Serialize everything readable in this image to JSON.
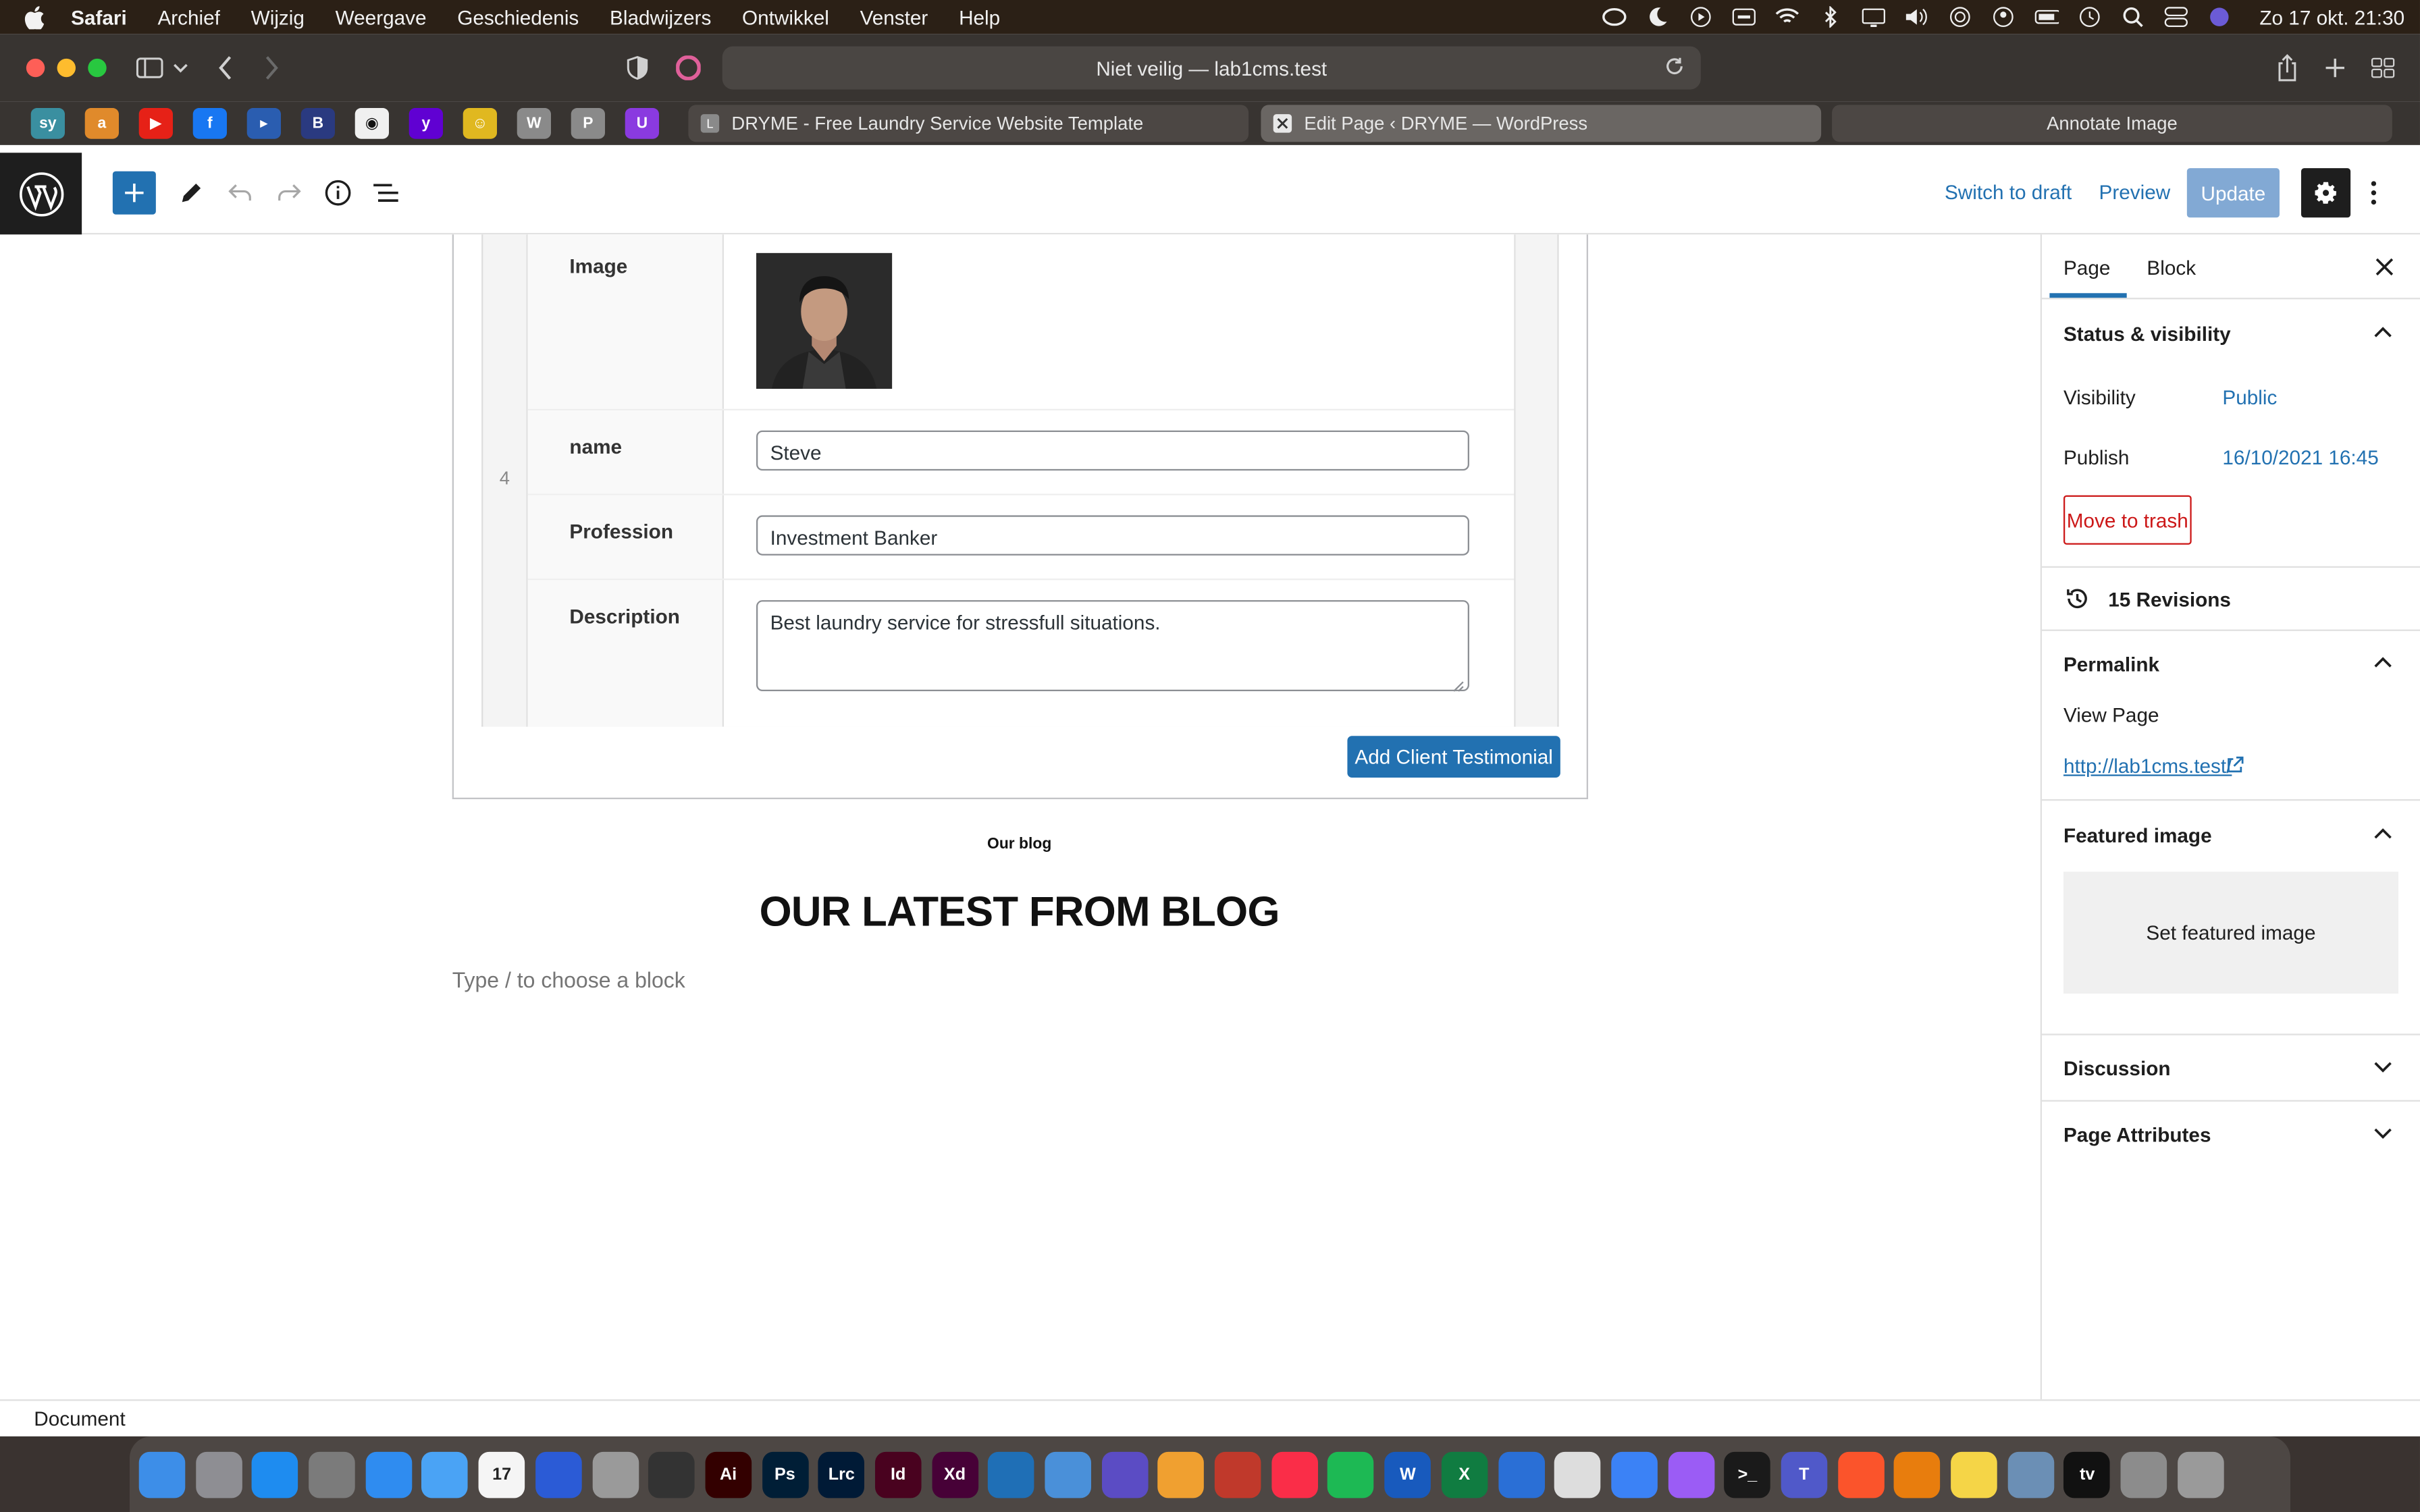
{
  "menubar": {
    "items": [
      "Safari",
      "Archief",
      "Wijzig",
      "Weergave",
      "Geschiedenis",
      "Bladwijzers",
      "Ontwikkel",
      "Venster",
      "Help"
    ],
    "clock": "Zo 17 okt.  21:30"
  },
  "browser": {
    "address": "Niet veilig — lab1cms.test",
    "tabs": [
      {
        "label": "DRYME - Free Laundry Service Website Template",
        "favicon": "L"
      },
      {
        "label": "Edit Page ‹ DRYME — WordPress",
        "favicon": "wp"
      },
      {
        "label": "Annotate Image",
        "favicon": ""
      }
    ],
    "favorites": [
      "sy",
      "a",
      "youtube",
      "facebook",
      "play",
      "B",
      "github",
      "y",
      "slack",
      "W",
      "P",
      "U"
    ]
  },
  "wp_header": {
    "switch_to_draft": "Switch to draft",
    "preview": "Preview",
    "update": "Update"
  },
  "testimonial": {
    "row_number": "4",
    "image_label": "Image",
    "name_label": "name",
    "name_value": "Steve",
    "profession_label": "Profession",
    "profession_value": "Investment Banker",
    "description_label": "Description",
    "description_value": "Best laundry service for stressfull situations.",
    "add_button": "Add Client Testimonial"
  },
  "blog": {
    "subtitle": "Our blog",
    "title": "OUR LATEST FROM BLOG",
    "placeholder": "Type / to choose a block"
  },
  "sidebar": {
    "tabs": [
      "Page",
      "Block"
    ],
    "status_visibility": "Status & visibility",
    "visibility_label": "Visibility",
    "visibility_value": "Public",
    "publish_label": "Publish",
    "publish_value": "16/10/2021 16:45",
    "move_to_trash": "Move to trash",
    "revisions": "15 Revisions",
    "permalink": "Permalink",
    "view_page": "View Page",
    "permalink_url": "http://lab1cms.test/",
    "featured_image": "Featured image",
    "set_featured_image": "Set featured image",
    "discussion": "Discussion",
    "page_attributes": "Page Attributes"
  },
  "footer": {
    "breadcrumb": "Document"
  },
  "dock": {
    "apps": [
      {
        "name": "finder",
        "color": "#3d8ee8",
        "label": ""
      },
      {
        "name": "launchpad",
        "color": "#8e8e93",
        "label": ""
      },
      {
        "name": "app-store",
        "color": "#1e8cf0",
        "label": ""
      },
      {
        "name": "system-preferences",
        "color": "#7b7b7b",
        "label": ""
      },
      {
        "name": "safari",
        "color": "#2f8cf0",
        "label": ""
      },
      {
        "name": "mail",
        "color": "#4aa3f5",
        "label": ""
      },
      {
        "name": "calendar",
        "color": "#f5f5f5",
        "label": "17"
      },
      {
        "name": "siri",
        "color": "#2b5bd6",
        "label": ""
      },
      {
        "name": "compressor",
        "color": "#9a9a9a",
        "label": ""
      },
      {
        "name": "final-cut",
        "color": "#333333",
        "label": ""
      },
      {
        "name": "illustrator",
        "color": "#330000",
        "label": "Ai"
      },
      {
        "name": "photoshop",
        "color": "#001e36",
        "label": "Ps"
      },
      {
        "name": "lightroom-classic",
        "color": "#001a36",
        "label": "Lrc"
      },
      {
        "name": "indesign",
        "color": "#49021f",
        "label": "Id"
      },
      {
        "name": "xd",
        "color": "#470137",
        "label": "Xd"
      },
      {
        "name": "vscode",
        "color": "#1f6fb6",
        "label": ""
      },
      {
        "name": "xcode-tool",
        "color": "#4a90d9",
        "label": ""
      },
      {
        "name": "nova",
        "color": "#5b4cc4",
        "label": ""
      },
      {
        "name": "cloud",
        "color": "#f0a030",
        "label": ""
      },
      {
        "name": "database",
        "color": "#c0392b",
        "label": ""
      },
      {
        "name": "music",
        "color": "#fa2d48",
        "label": ""
      },
      {
        "name": "spotify",
        "color": "#1db954",
        "label": ""
      },
      {
        "name": "word",
        "color": "#185abd",
        "label": "W"
      },
      {
        "name": "excel",
        "color": "#107c41",
        "label": "X"
      },
      {
        "name": "firefox",
        "color": "#2a6fd6",
        "label": ""
      },
      {
        "name": "chrome",
        "color": "#dddddd",
        "label": ""
      },
      {
        "name": "sync",
        "color": "#3b82f6",
        "label": ""
      },
      {
        "name": "messenger",
        "color": "#9b5cf5",
        "label": ""
      },
      {
        "name": "terminal",
        "color": "#1a1a1a",
        "label": ">_"
      },
      {
        "name": "teams",
        "color": "#5059c9",
        "label": "T"
      },
      {
        "name": "brave",
        "color": "#fb542b",
        "label": ""
      },
      {
        "name": "blender",
        "color": "#e87d0d",
        "label": ""
      },
      {
        "name": "notes",
        "color": "#f5d547",
        "label": ""
      },
      {
        "name": "preview",
        "color": "#6b8fb5",
        "label": ""
      },
      {
        "name": "apple-tv",
        "color": "#111111",
        "label": "tv"
      },
      {
        "name": "documents",
        "color": "#8c8c8c",
        "label": ""
      },
      {
        "name": "trash",
        "color": "#9a9a9a",
        "label": ""
      }
    ]
  }
}
